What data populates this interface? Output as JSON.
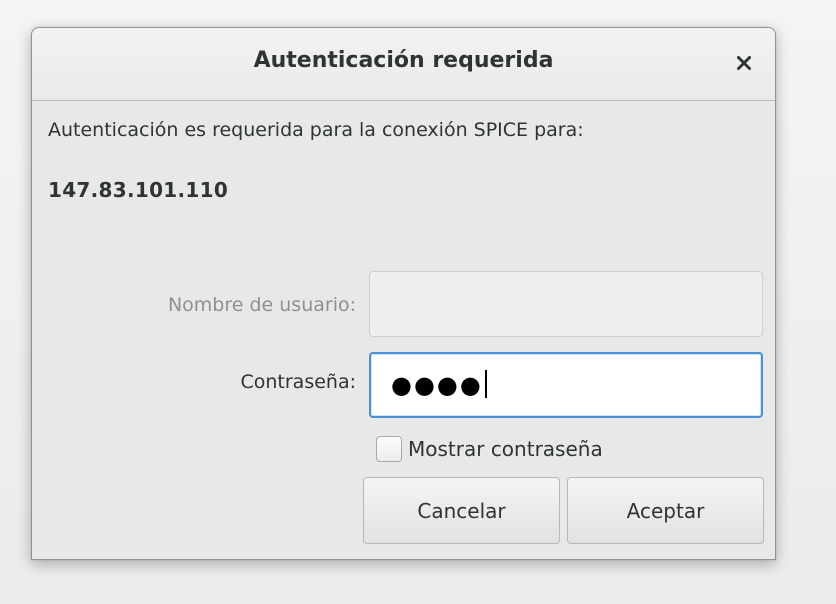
{
  "dialog": {
    "title": "Autenticación requerida",
    "close_icon": "close-icon",
    "message": "Autenticación es requerida para la conexión SPICE para:",
    "host": "147.83.101.110"
  },
  "form": {
    "username_label": "Nombre de usuario:",
    "username_value": "",
    "password_label": "Contraseña:",
    "password_masked": "●●●●",
    "show_password_label": "Mostrar contraseña",
    "show_password_checked": false
  },
  "buttons": {
    "cancel_label": "Cancelar",
    "accept_label": "Aceptar"
  },
  "colors": {
    "focus_accent": "#4a90d9",
    "text": "#2e3436",
    "disabled_text": "#8d9191"
  }
}
